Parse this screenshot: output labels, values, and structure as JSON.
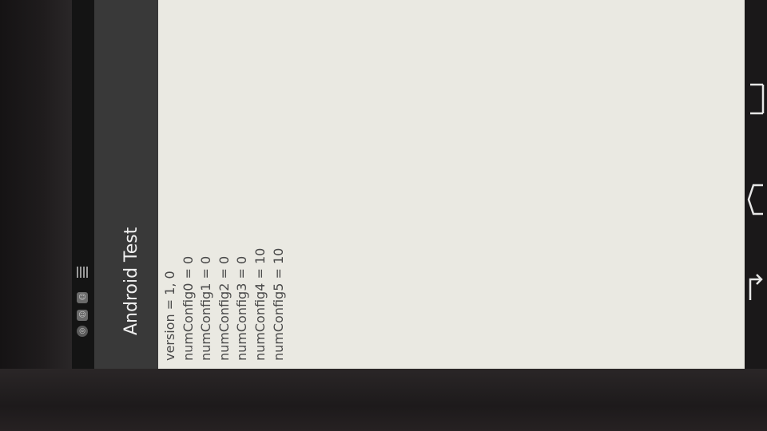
{
  "action_bar": {
    "title": "Android Test"
  },
  "content": {
    "lines": [
      "version = 1, 0",
      "numConfig0 = 0",
      "numConfig1 = 0",
      "numConfig2 = 0",
      "numConfig3 = 0",
      "numConfig4 = 10",
      "numConfig5 = 10"
    ]
  },
  "status_bar": {
    "icons": [
      "notification-icon",
      "android-icon",
      "android-icon",
      "signal-icon"
    ]
  },
  "nav_bar": {
    "icons": [
      "back-icon",
      "home-icon",
      "recents-icon"
    ]
  },
  "colors": {
    "screen_background": "#eae9e2",
    "action_bar": "#393939",
    "status_bar": "#141414",
    "text": "#4a4a4a"
  }
}
